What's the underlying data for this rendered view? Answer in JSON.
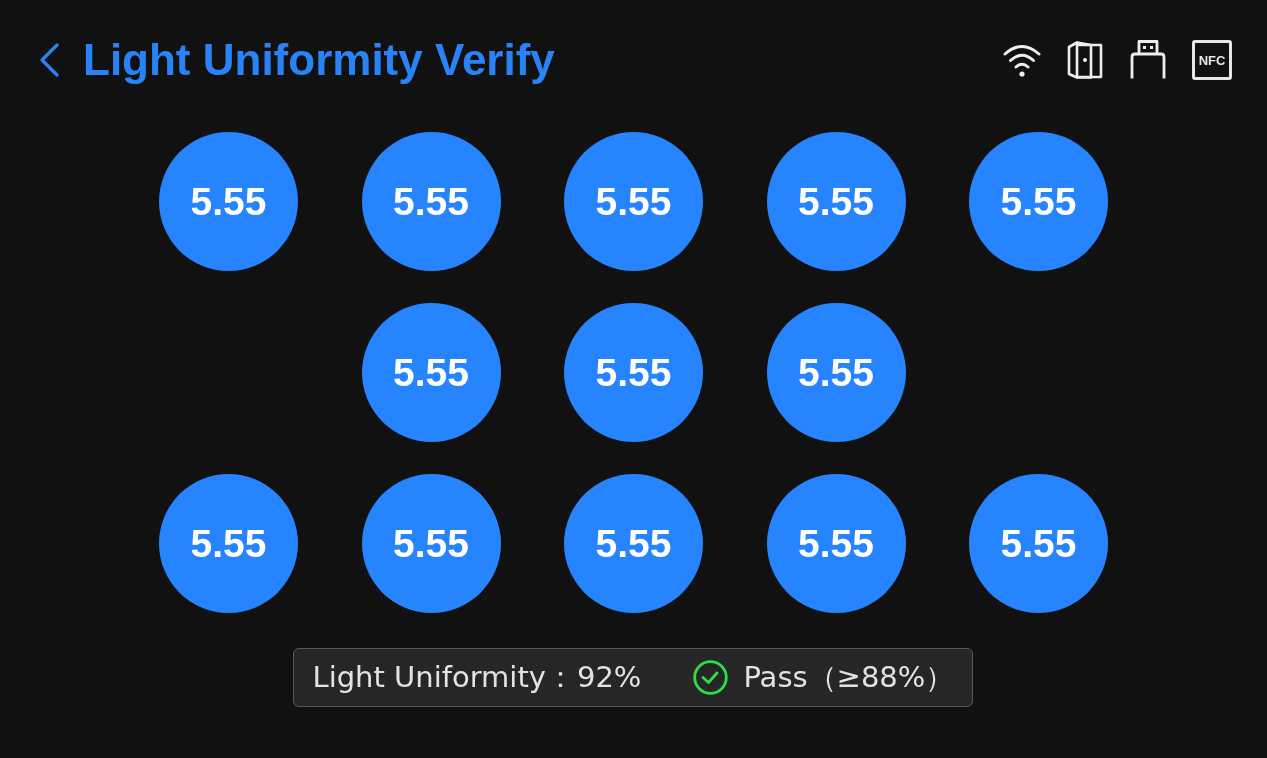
{
  "header": {
    "title": "Light Uniformity Verify",
    "status_icons": [
      {
        "kind": "wifi"
      },
      {
        "kind": "door"
      },
      {
        "kind": "usb"
      },
      {
        "kind": "nfc",
        "label": "NFC"
      }
    ]
  },
  "rows": [
    {
      "points": [
        {
          "value": "5.55"
        },
        {
          "value": "5.55"
        },
        {
          "value": "5.55"
        },
        {
          "value": "5.55"
        },
        {
          "value": "5.55"
        }
      ]
    },
    {
      "points": [
        {
          "value": "5.55"
        },
        {
          "value": "5.55"
        },
        {
          "value": "5.55"
        }
      ]
    },
    {
      "points": [
        {
          "value": "5.55"
        },
        {
          "value": "5.55"
        },
        {
          "value": "5.55"
        },
        {
          "value": "5.55"
        },
        {
          "value": "5.55"
        }
      ]
    }
  ],
  "result": {
    "label": "Light Uniformity：",
    "value": "92%",
    "status": {
      "kind": "pass",
      "text": "Pass（≥88%）"
    }
  }
}
